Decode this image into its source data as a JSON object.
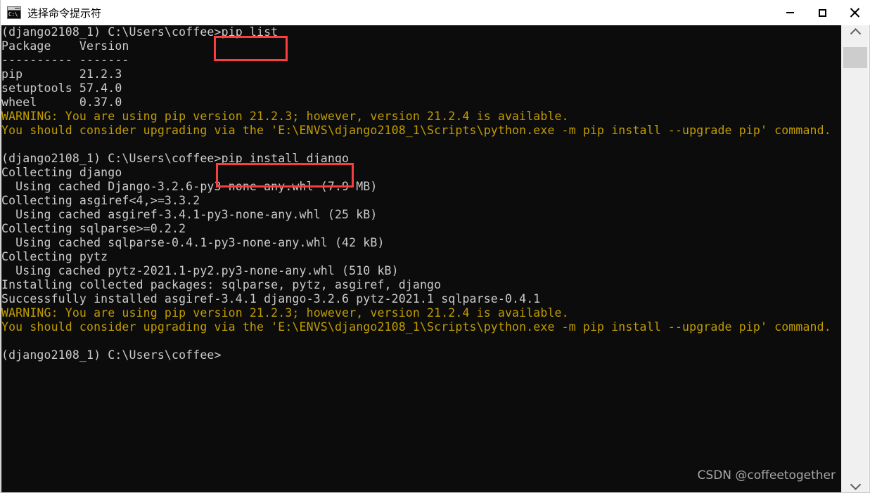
{
  "window": {
    "title": "选择命令提示符",
    "icon": "cmd-console-icon",
    "icon_text": "C:\\",
    "controls": [
      {
        "name": "minimize",
        "glyph": "minimize-icon"
      },
      {
        "name": "maximize",
        "glyph": "maximize-icon"
      },
      {
        "name": "close",
        "glyph": "close-icon"
      }
    ]
  },
  "terminal": {
    "background_color": "#0c0c0c",
    "default_text_color": "#cccccc",
    "warning_text_color": "#c19c00",
    "prompt": "(django2108_1) C:\\Users\\coffee>",
    "lines": [
      {
        "text": "(django2108_1) C:\\Users\\coffee>pip list",
        "color": "white"
      },
      {
        "text": "Package    Version",
        "color": "white"
      },
      {
        "text": "---------- -------",
        "color": "white"
      },
      {
        "text": "pip        21.2.3",
        "color": "white"
      },
      {
        "text": "setuptools 57.4.0",
        "color": "white"
      },
      {
        "text": "wheel      0.37.0",
        "color": "white"
      },
      {
        "text": "WARNING: You are using pip version 21.2.3; however, version 21.2.4 is available.",
        "color": "yellow"
      },
      {
        "text": "You should consider upgrading via the 'E:\\ENVS\\django2108_1\\Scripts\\python.exe -m pip install --upgrade pip' command.",
        "color": "yellow"
      },
      {
        "text": "",
        "color": "white"
      },
      {
        "text": "(django2108_1) C:\\Users\\coffee>pip install django",
        "color": "white"
      },
      {
        "text": "Collecting django",
        "color": "white"
      },
      {
        "text": "  Using cached Django-3.2.6-py3-none-any.whl (7.9 MB)",
        "color": "white"
      },
      {
        "text": "Collecting asgiref<4,>=3.3.2",
        "color": "white"
      },
      {
        "text": "  Using cached asgiref-3.4.1-py3-none-any.whl (25 kB)",
        "color": "white"
      },
      {
        "text": "Collecting sqlparse>=0.2.2",
        "color": "white"
      },
      {
        "text": "  Using cached sqlparse-0.4.1-py3-none-any.whl (42 kB)",
        "color": "white"
      },
      {
        "text": "Collecting pytz",
        "color": "white"
      },
      {
        "text": "  Using cached pytz-2021.1-py2.py3-none-any.whl (510 kB)",
        "color": "white"
      },
      {
        "text": "Installing collected packages: sqlparse, pytz, asgiref, django",
        "color": "white"
      },
      {
        "text": "Successfully installed asgiref-3.4.1 django-3.2.6 pytz-2021.1 sqlparse-0.4.1",
        "color": "white"
      },
      {
        "text": "WARNING: You are using pip version 21.2.3; however, version 21.2.4 is available.",
        "color": "yellow"
      },
      {
        "text": "You should consider upgrading via the 'E:\\ENVS\\django2108_1\\Scripts\\python.exe -m pip install --upgrade pip' command.",
        "color": "yellow"
      },
      {
        "text": "",
        "color": "white"
      },
      {
        "text": "(django2108_1) C:\\Users\\coffee>",
        "color": "white"
      }
    ],
    "commands_highlighted": [
      {
        "text": "pip list",
        "box_color": "#fc3d3d"
      },
      {
        "text": "pip install django",
        "box_color": "#fc3d3d"
      }
    ],
    "packages_listed": [
      {
        "name": "pip",
        "version": "21.2.3"
      },
      {
        "name": "setuptools",
        "version": "57.4.0"
      },
      {
        "name": "wheel",
        "version": "0.37.0"
      }
    ],
    "packages_installed": [
      {
        "name": "asgiref",
        "version": "3.4.1"
      },
      {
        "name": "django",
        "version": "3.2.6"
      },
      {
        "name": "pytz",
        "version": "2021.1"
      },
      {
        "name": "sqlparse",
        "version": "0.4.1"
      }
    ]
  },
  "watermark": {
    "text": "CSDN @coffeetogether"
  },
  "scrollbar": {
    "up_arrow": "chevron-up-icon",
    "down_arrow": "chevron-down-icon"
  }
}
